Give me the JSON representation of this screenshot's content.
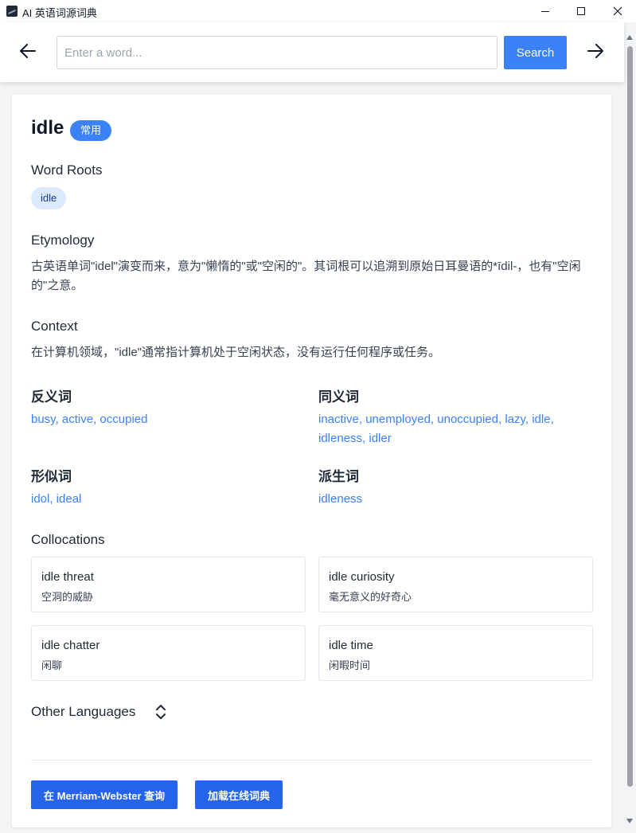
{
  "window": {
    "title": "AI 英语词源词典"
  },
  "toolbar": {
    "search_placeholder": "Enter a word...",
    "search_value": "",
    "search_label": "Search"
  },
  "entry": {
    "word": "idle",
    "badge": "常用",
    "roots_title": "Word Roots",
    "roots": [
      "idle"
    ],
    "etymology_title": "Etymology",
    "etymology": "古英语单词\"idel\"演变而来，意为\"懒惰的\"或\"空闲的\"。其词根可以追溯到原始日耳曼语的*īdil-，也有\"空闲的\"之意。",
    "context_title": "Context",
    "context": "在计算机领域，\"idle\"通常指计算机处于空闲状态，没有运行任何程序或任务。",
    "antonyms_title": "反义词",
    "antonyms": "busy, active, occupied",
    "synonyms_title": "同义词",
    "synonyms": "inactive, unemployed, unoccupied, lazy, idle, idleness, idler",
    "similar_title": "形似词",
    "similar": "idol, ideal",
    "derived_title": "派生词",
    "derived": "idleness",
    "collocations_title": "Collocations",
    "collocations": [
      {
        "en": "idle threat",
        "zh": "空洞的威胁"
      },
      {
        "en": "idle curiosity",
        "zh": "毫无意义的好奇心"
      },
      {
        "en": "idle chatter",
        "zh": "闲聊"
      },
      {
        "en": "idle time",
        "zh": "闲暇时间"
      }
    ],
    "other_languages_title": "Other Languages"
  },
  "actions": {
    "merriam_webster": "在 Merriam-Webster 查询",
    "load_online": "加载在线词典"
  },
  "colors": {
    "accent": "#3b82f6",
    "button": "#2563eb",
    "chip_bg": "#dbeafe",
    "link": "#3b82f6"
  }
}
